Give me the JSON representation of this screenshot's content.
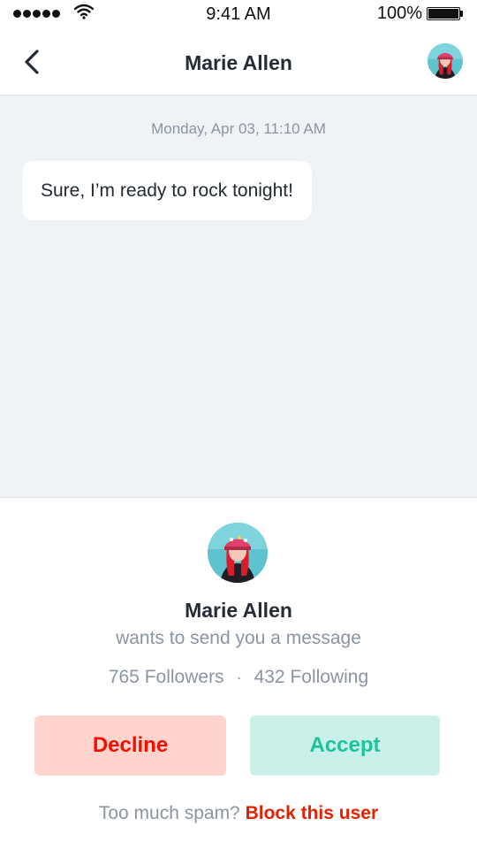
{
  "status_bar": {
    "time": "9:41 AM",
    "battery_percent": "100%",
    "signal_icon": "signal-dots-icon",
    "wifi_icon": "wifi-icon",
    "battery_icon": "battery-icon"
  },
  "nav": {
    "back_icon": "chevron-left-icon",
    "title": "Marie Allen",
    "avatar_icon": "user-avatar"
  },
  "chat": {
    "timestamp": "Monday, Apr 03, 11:10 AM",
    "messages": [
      {
        "text": "Sure, I’m ready to rock tonight!"
      }
    ]
  },
  "request": {
    "name": "Marie Allen",
    "subtitle": "wants to send you a message",
    "followers_count": "765",
    "followers_label": "Followers",
    "separator": "·",
    "following_count": "432",
    "following_label": "Following",
    "decline_label": "Decline",
    "accept_label": "Accept",
    "spam_prompt": "Too much spam?",
    "block_label": "Block this user"
  },
  "colors": {
    "chat_background": "#eff3f6",
    "decline_bg": "#ffd4cc",
    "decline_text": "#f20f00",
    "accept_bg": "#c9f1e9",
    "accept_text": "#1cc49c",
    "block_link": "#e81e00",
    "muted_text": "#8a94a3"
  }
}
